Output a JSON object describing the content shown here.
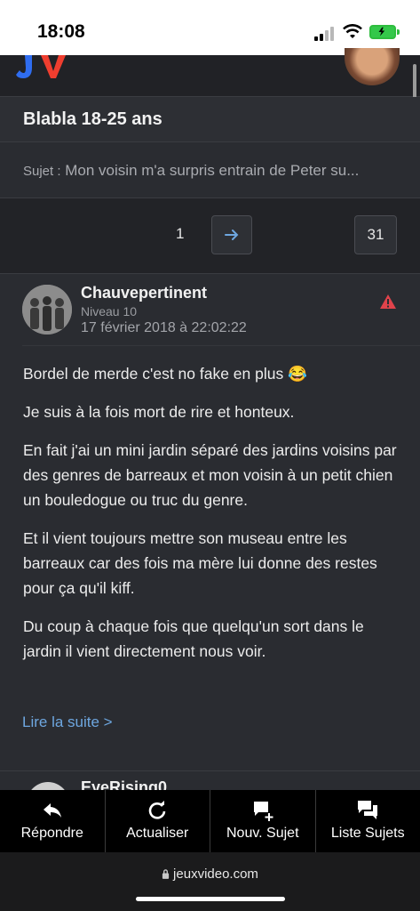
{
  "status": {
    "time": "18:08"
  },
  "header": {
    "logo_alt": "JV"
  },
  "forum": {
    "title": "Blabla 18-25 ans"
  },
  "subject": {
    "prefix": "Sujet :",
    "title": "Mon voisin m'a surpris entrain de Peter su..."
  },
  "pagination": {
    "current_page": "1",
    "last_page": "31"
  },
  "post": {
    "author": "Chauvepertinent",
    "level": "Niveau 10",
    "date": "17 février 2018 à 22:02:22",
    "paragraphs": [
      "Bordel de merde c'est no fake en plus 😂",
      "Je suis à la fois mort de rire et honteux.",
      "En fait j'ai un mini jardin séparé des jardins voisins par des genres de barreaux et mon voisin à un petit chien un bouledogue ou truc du genre.",
      "Et il vient toujours mettre son museau entre les barreaux car des fois ma mère lui donne des restes pour ça qu'il kiff.",
      "Du coup à chaque fois que quelqu'un sort dans le jardin il vient directement nous voir."
    ],
    "read_more": "Lire la suite >"
  },
  "next_post": {
    "author": "EyeRising0"
  },
  "bottom_bar": {
    "reply": "Répondre",
    "refresh": "Actualiser",
    "new_topic": "Nouv. Sujet",
    "topic_list": "Liste Sujets"
  },
  "browser": {
    "url": "jeuxvideo.com"
  },
  "colors": {
    "accent": "#6ea7e0",
    "warning": "#e0434b",
    "logo_blue": "#2f6df0",
    "logo_red": "#ef3e2f"
  }
}
